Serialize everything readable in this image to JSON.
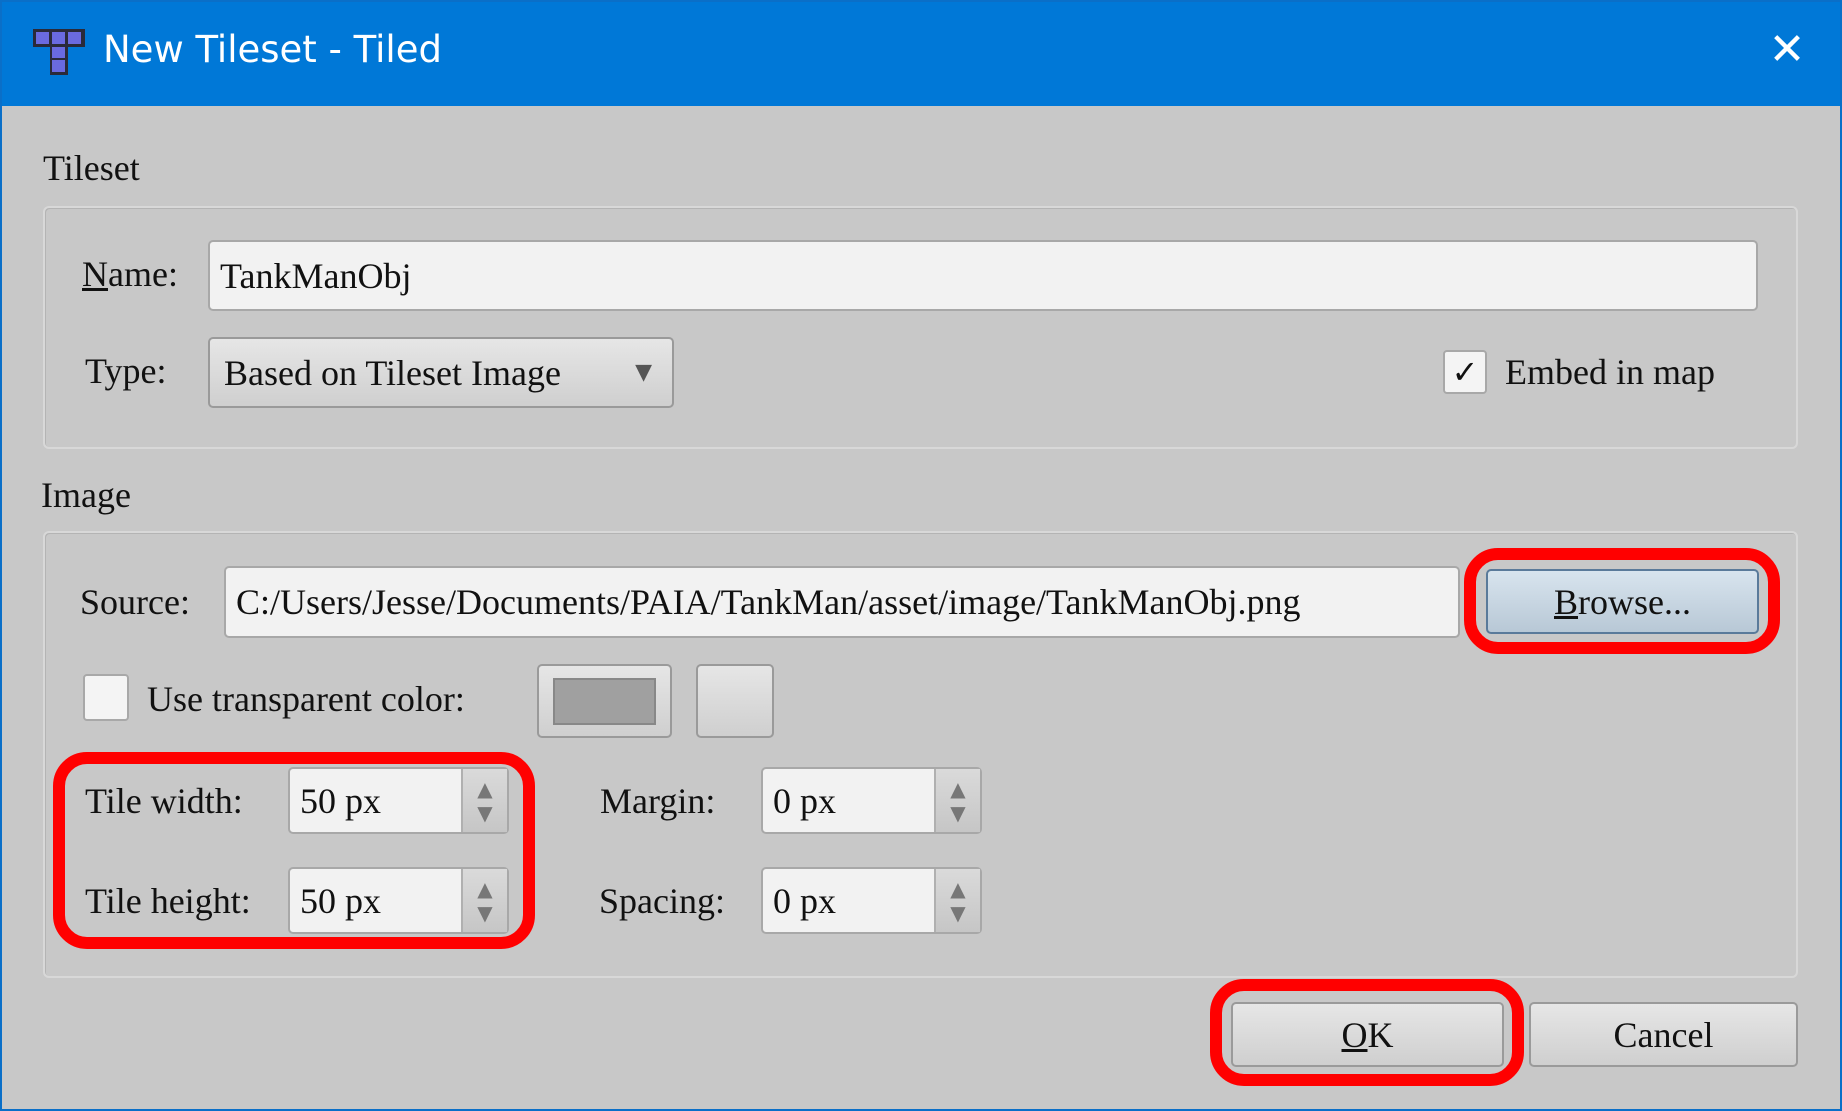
{
  "window": {
    "title": "New Tileset - Tiled",
    "app_icon": "tiled-icon",
    "close_icon": "close-icon"
  },
  "tileset_group": {
    "label": "Tileset",
    "name_label": "Name:",
    "name_value": "TankManObj",
    "type_label": "Type:",
    "type_value": "Based on Tileset Image",
    "embed_label": "Embed in map",
    "embed_checked": true
  },
  "image_group": {
    "label": "Image",
    "source_label": "Source:",
    "source_value": "C:/Users/Jesse/Documents/PAIA/TankMan/asset/image/TankManObj.png",
    "browse_label": "Browse...",
    "transparent_label": "Use transparent color:",
    "transparent_checked": false,
    "transparent_color": "#a0a0a0",
    "tile_width_label": "Tile width:",
    "tile_width_value": "50 px",
    "tile_height_label": "Tile height:",
    "tile_height_value": "50 px",
    "margin_label": "Margin:",
    "margin_value": "0 px",
    "spacing_label": "Spacing:",
    "spacing_value": "0 px"
  },
  "buttons": {
    "ok_label": "OK",
    "cancel_label": "Cancel"
  },
  "highlight_color": "#ff0000"
}
